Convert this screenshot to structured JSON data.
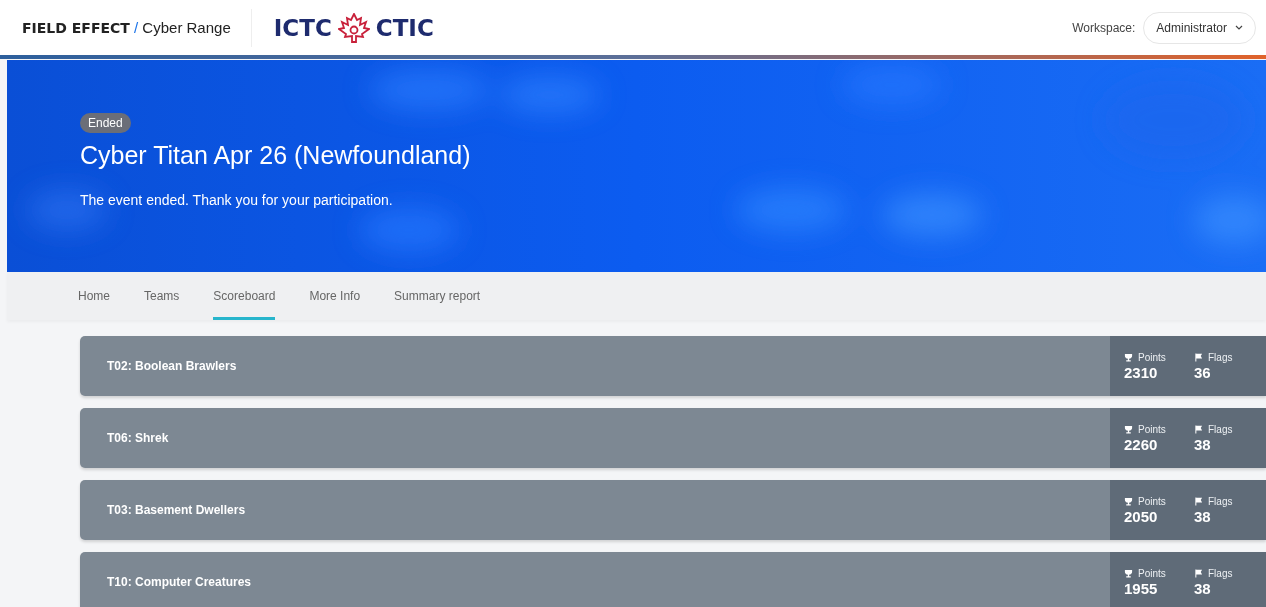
{
  "header": {
    "brand": "FIELD EFFECT",
    "separator": "/",
    "product": "Cyber Range",
    "logo_left": "ICTC",
    "logo_right": "CTIC",
    "workspace_label": "Workspace:",
    "workspace_value": "Administrator"
  },
  "banner": {
    "status": "Ended",
    "title": "Cyber Titan Apr 26 (Newfoundland)",
    "message": "The event ended. Thank you for your participation."
  },
  "tabs": [
    {
      "label": "Home",
      "selected": false
    },
    {
      "label": "Teams",
      "selected": false
    },
    {
      "label": "Scoreboard",
      "selected": true
    },
    {
      "label": "More Info",
      "selected": false
    },
    {
      "label": "Summary report",
      "selected": false
    }
  ],
  "teams": [
    {
      "name": "T02: Boolean Brawlers",
      "points_label": "Points",
      "points": "2310",
      "flags_label": "Flags",
      "flags": "36"
    },
    {
      "name": "T06: Shrek",
      "points_label": "Points",
      "points": "2260",
      "flags_label": "Flags",
      "flags": "38"
    },
    {
      "name": "T03: Basement Dwellers",
      "points_label": "Points",
      "points": "2050",
      "flags_label": "Flags",
      "flags": "38"
    },
    {
      "name": "T10: Computer Creatures",
      "points_label": "Points",
      "points": "1955",
      "flags_label": "Flags",
      "flags": "38"
    }
  ]
}
